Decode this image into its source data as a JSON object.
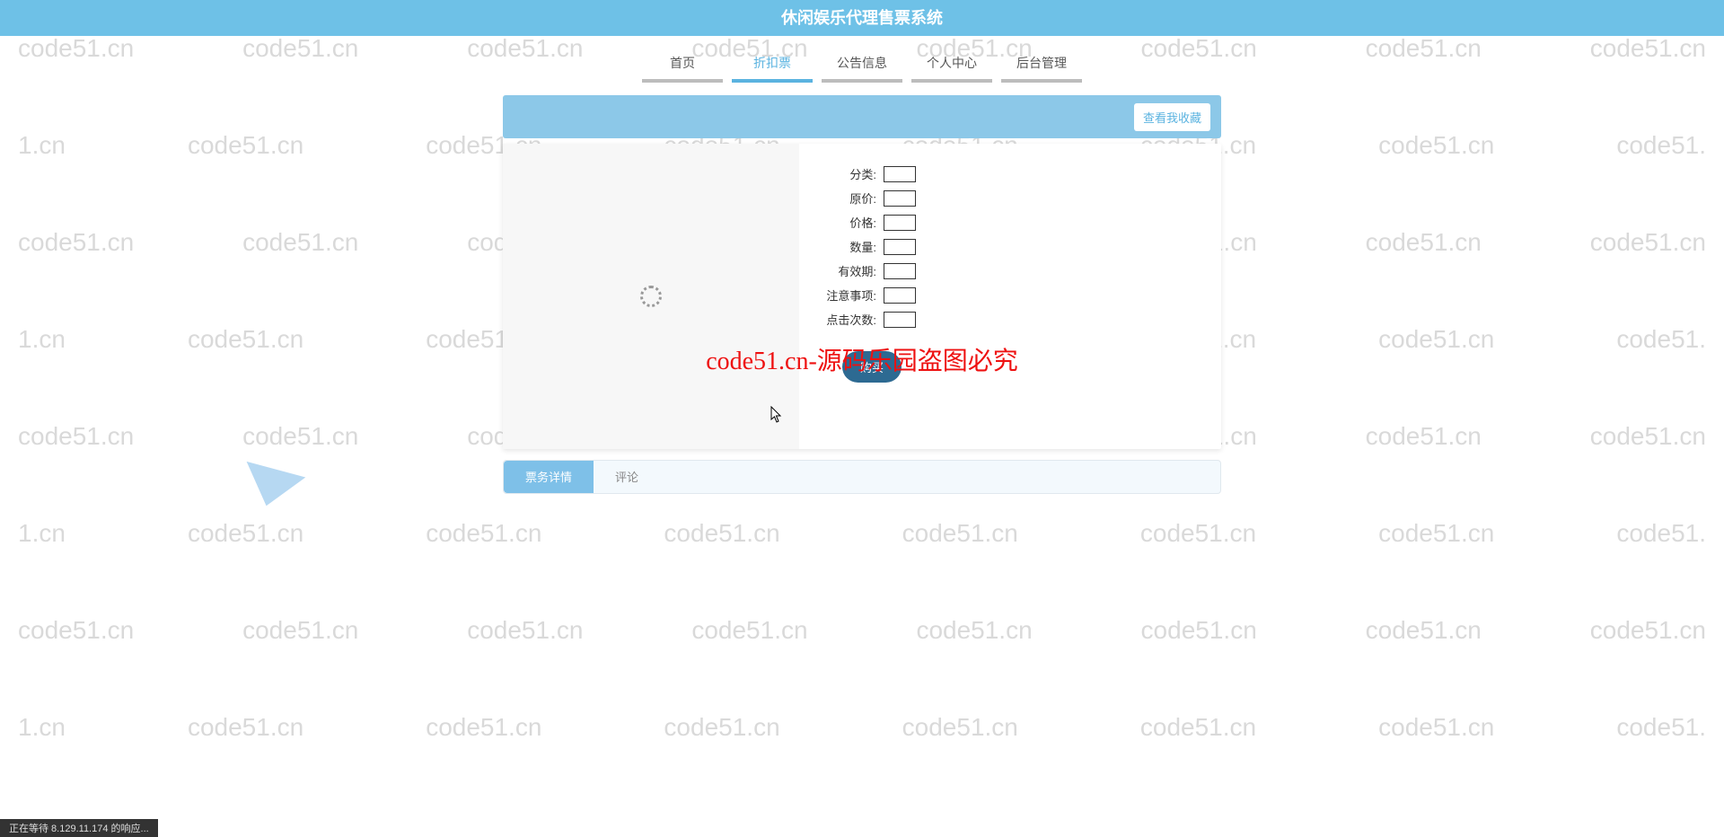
{
  "watermark_text": "code51.cn",
  "overlay_text": "code51.cn-源码乐园盗图必究",
  "header": {
    "title": "休闲娱乐代理售票系统"
  },
  "nav": {
    "items": [
      {
        "label": "首页",
        "active": false
      },
      {
        "label": "折扣票",
        "active": true
      },
      {
        "label": "公告信息",
        "active": false
      },
      {
        "label": "个人中心",
        "active": false
      },
      {
        "label": "后台管理",
        "active": false
      }
    ]
  },
  "card": {
    "favorites_button": "查看我收藏"
  },
  "fields": [
    {
      "label": "分类:",
      "value": ""
    },
    {
      "label": "原价:",
      "value": ""
    },
    {
      "label": "价格:",
      "value": ""
    },
    {
      "label": "数量:",
      "value": ""
    },
    {
      "label": "有效期:",
      "value": ""
    },
    {
      "label": "注意事项:",
      "value": ""
    },
    {
      "label": "点击次数:",
      "value": ""
    }
  ],
  "buy_button": "购买",
  "tabs": [
    {
      "label": "票务详情",
      "active": true
    },
    {
      "label": "评论",
      "active": false
    }
  ],
  "status_bar": "正在等待 8.129.11.174 的响应...",
  "colors": {
    "primary": "#6ec1e7",
    "primary_light": "#8cc8e8",
    "nav_active": "#5bb3e0",
    "buy": "#2d6a92"
  }
}
